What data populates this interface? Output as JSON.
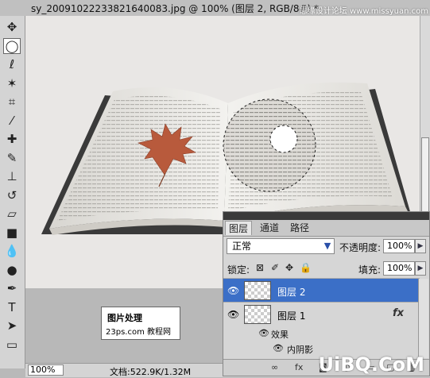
{
  "window": {
    "title": "sy_20091022233821640083.jpg @ 100% (图层 2, RGB/8#) *",
    "watermark_top": "思缘设计论坛 www.missyuan.com"
  },
  "tools": [
    {
      "name": "move-tool",
      "icon": "move-icon",
      "glyph": "✥"
    },
    {
      "name": "marquee-tool",
      "icon": "ellipse-marquee-icon",
      "glyph": "◯"
    },
    {
      "name": "lasso-tool",
      "icon": "lasso-icon",
      "glyph": "ℓ"
    },
    {
      "name": "magic-wand-tool",
      "icon": "magic-wand-icon",
      "glyph": "✶"
    },
    {
      "name": "crop-tool",
      "icon": "crop-icon",
      "glyph": "⌗"
    },
    {
      "name": "eyedropper-tool",
      "icon": "eyedropper-icon",
      "glyph": "⁄"
    },
    {
      "name": "healing-tool",
      "icon": "healing-brush-icon",
      "glyph": "✚"
    },
    {
      "name": "brush-tool",
      "icon": "brush-icon",
      "glyph": "✎"
    },
    {
      "name": "stamp-tool",
      "icon": "clone-stamp-icon",
      "glyph": "⊥"
    },
    {
      "name": "history-brush-tool",
      "icon": "history-brush-icon",
      "glyph": "↺"
    },
    {
      "name": "eraser-tool",
      "icon": "eraser-icon",
      "glyph": "▱"
    },
    {
      "name": "gradient-tool",
      "icon": "gradient-icon",
      "glyph": "■"
    },
    {
      "name": "blur-tool",
      "icon": "blur-drop-icon",
      "glyph": "💧"
    },
    {
      "name": "dodge-tool",
      "icon": "dodge-icon",
      "glyph": "●"
    },
    {
      "name": "pen-tool",
      "icon": "pen-icon",
      "glyph": "✒"
    },
    {
      "name": "type-tool",
      "icon": "type-icon",
      "glyph": "T"
    },
    {
      "name": "path-select-tool",
      "icon": "path-select-icon",
      "glyph": "➤"
    },
    {
      "name": "shape-tool",
      "icon": "rectangle-shape-icon",
      "glyph": "▭"
    }
  ],
  "canvas_watermark": {
    "line1": "图片处理",
    "line2": "23ps.com 教程网"
  },
  "status": {
    "zoom": "100%",
    "doc": "文档:522.9K/1.32M"
  },
  "layers_panel": {
    "tabs": [
      "图层",
      "通道",
      "路径"
    ],
    "blend_mode": "正常",
    "opacity_label": "不透明度:",
    "opacity_value": "100%",
    "lock_label": "锁定:",
    "fill_label": "填充:",
    "fill_value": "100%",
    "layers": [
      {
        "name": "图层 2",
        "selected": true
      },
      {
        "name": "图层 1",
        "selected": false,
        "fx": "fx"
      }
    ],
    "effects_label": "效果",
    "effect_item": "内阴影"
  },
  "bottom_watermark": "UiBQ.CoM",
  "colors": {
    "selection_blue": "#3b6fc7",
    "canvas_bg": "#e9e7e5",
    "leaf": "#b85a3c"
  }
}
